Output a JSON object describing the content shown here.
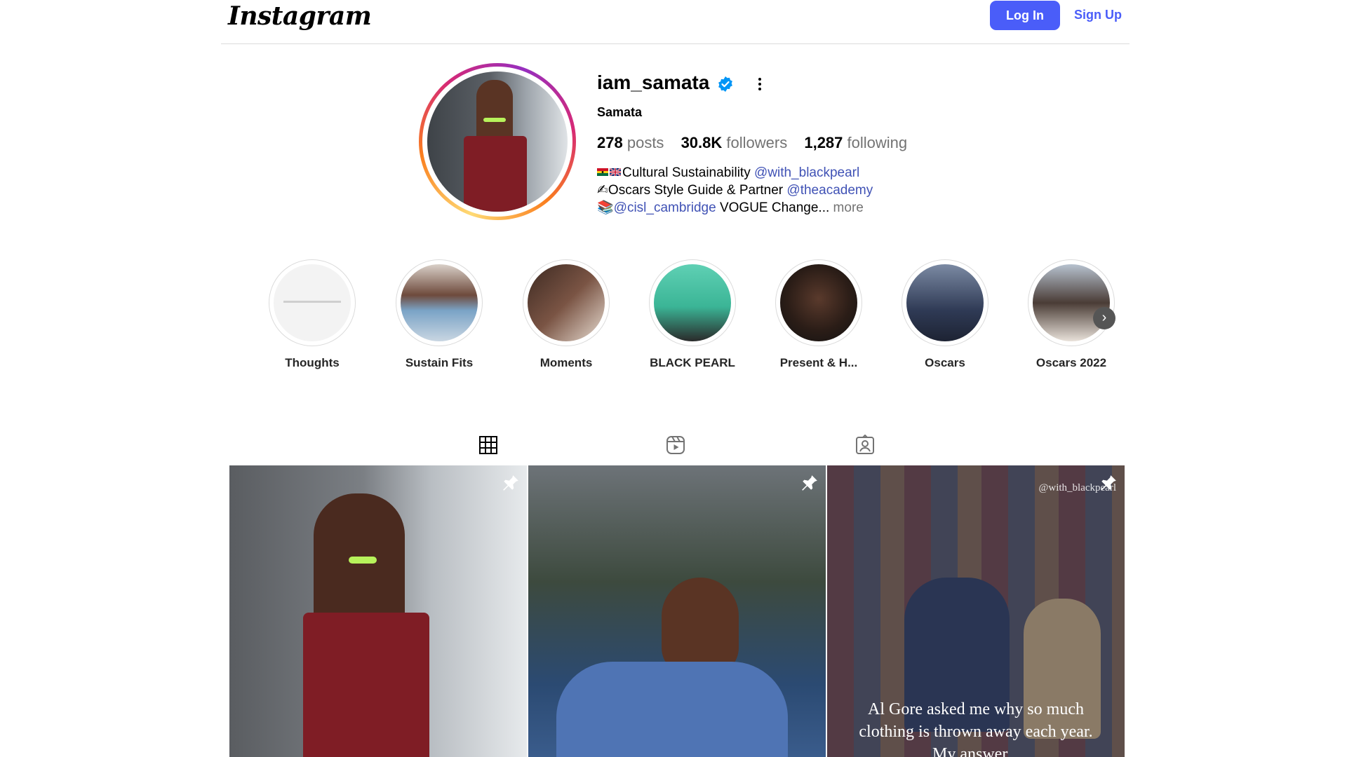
{
  "header": {
    "logo": "Instagram",
    "login_label": "Log In",
    "signup_label": "Sign Up",
    "accent_color": "#4a5df9"
  },
  "profile": {
    "username": "iam_samata",
    "verified": true,
    "full_name": "Samata",
    "stats": {
      "posts_count": "278",
      "posts_label": "posts",
      "followers_count": "30.8K",
      "followers_label": "followers",
      "following_count": "1,287",
      "following_label": "following"
    },
    "bio": {
      "line1_text": "Cultural Sustainability ",
      "line1_mention": "@with_blackpearl",
      "line2_text": "Oscars Style Guide & Partner ",
      "line2_mention": "@theacademy",
      "line3_mention": "@cisl_cambridge",
      "line3_text": " VOGUE Change... ",
      "more_label": "more"
    }
  },
  "highlights": [
    {
      "label": "Thoughts"
    },
    {
      "label": "Sustain Fits"
    },
    {
      "label": "Moments"
    },
    {
      "label": "BLACK PEARL"
    },
    {
      "label": "Present & H..."
    },
    {
      "label": "Oscars"
    },
    {
      "label": "Oscars 2022"
    }
  ],
  "tabs": [
    {
      "icon": "grid-icon",
      "active": true
    },
    {
      "icon": "reels-icon",
      "active": false
    },
    {
      "icon": "tagged-icon",
      "active": false
    }
  ],
  "posts": [
    {
      "pinned": true,
      "caption": "",
      "watermark": ""
    },
    {
      "pinned": true,
      "caption": "",
      "watermark": ""
    },
    {
      "pinned": true,
      "caption_line1": "Al Gore asked me why so much",
      "caption_line2": "clothing  is thrown away each year.",
      "caption_line3": "My answer...",
      "watermark": "@with_blackpearl"
    }
  ]
}
